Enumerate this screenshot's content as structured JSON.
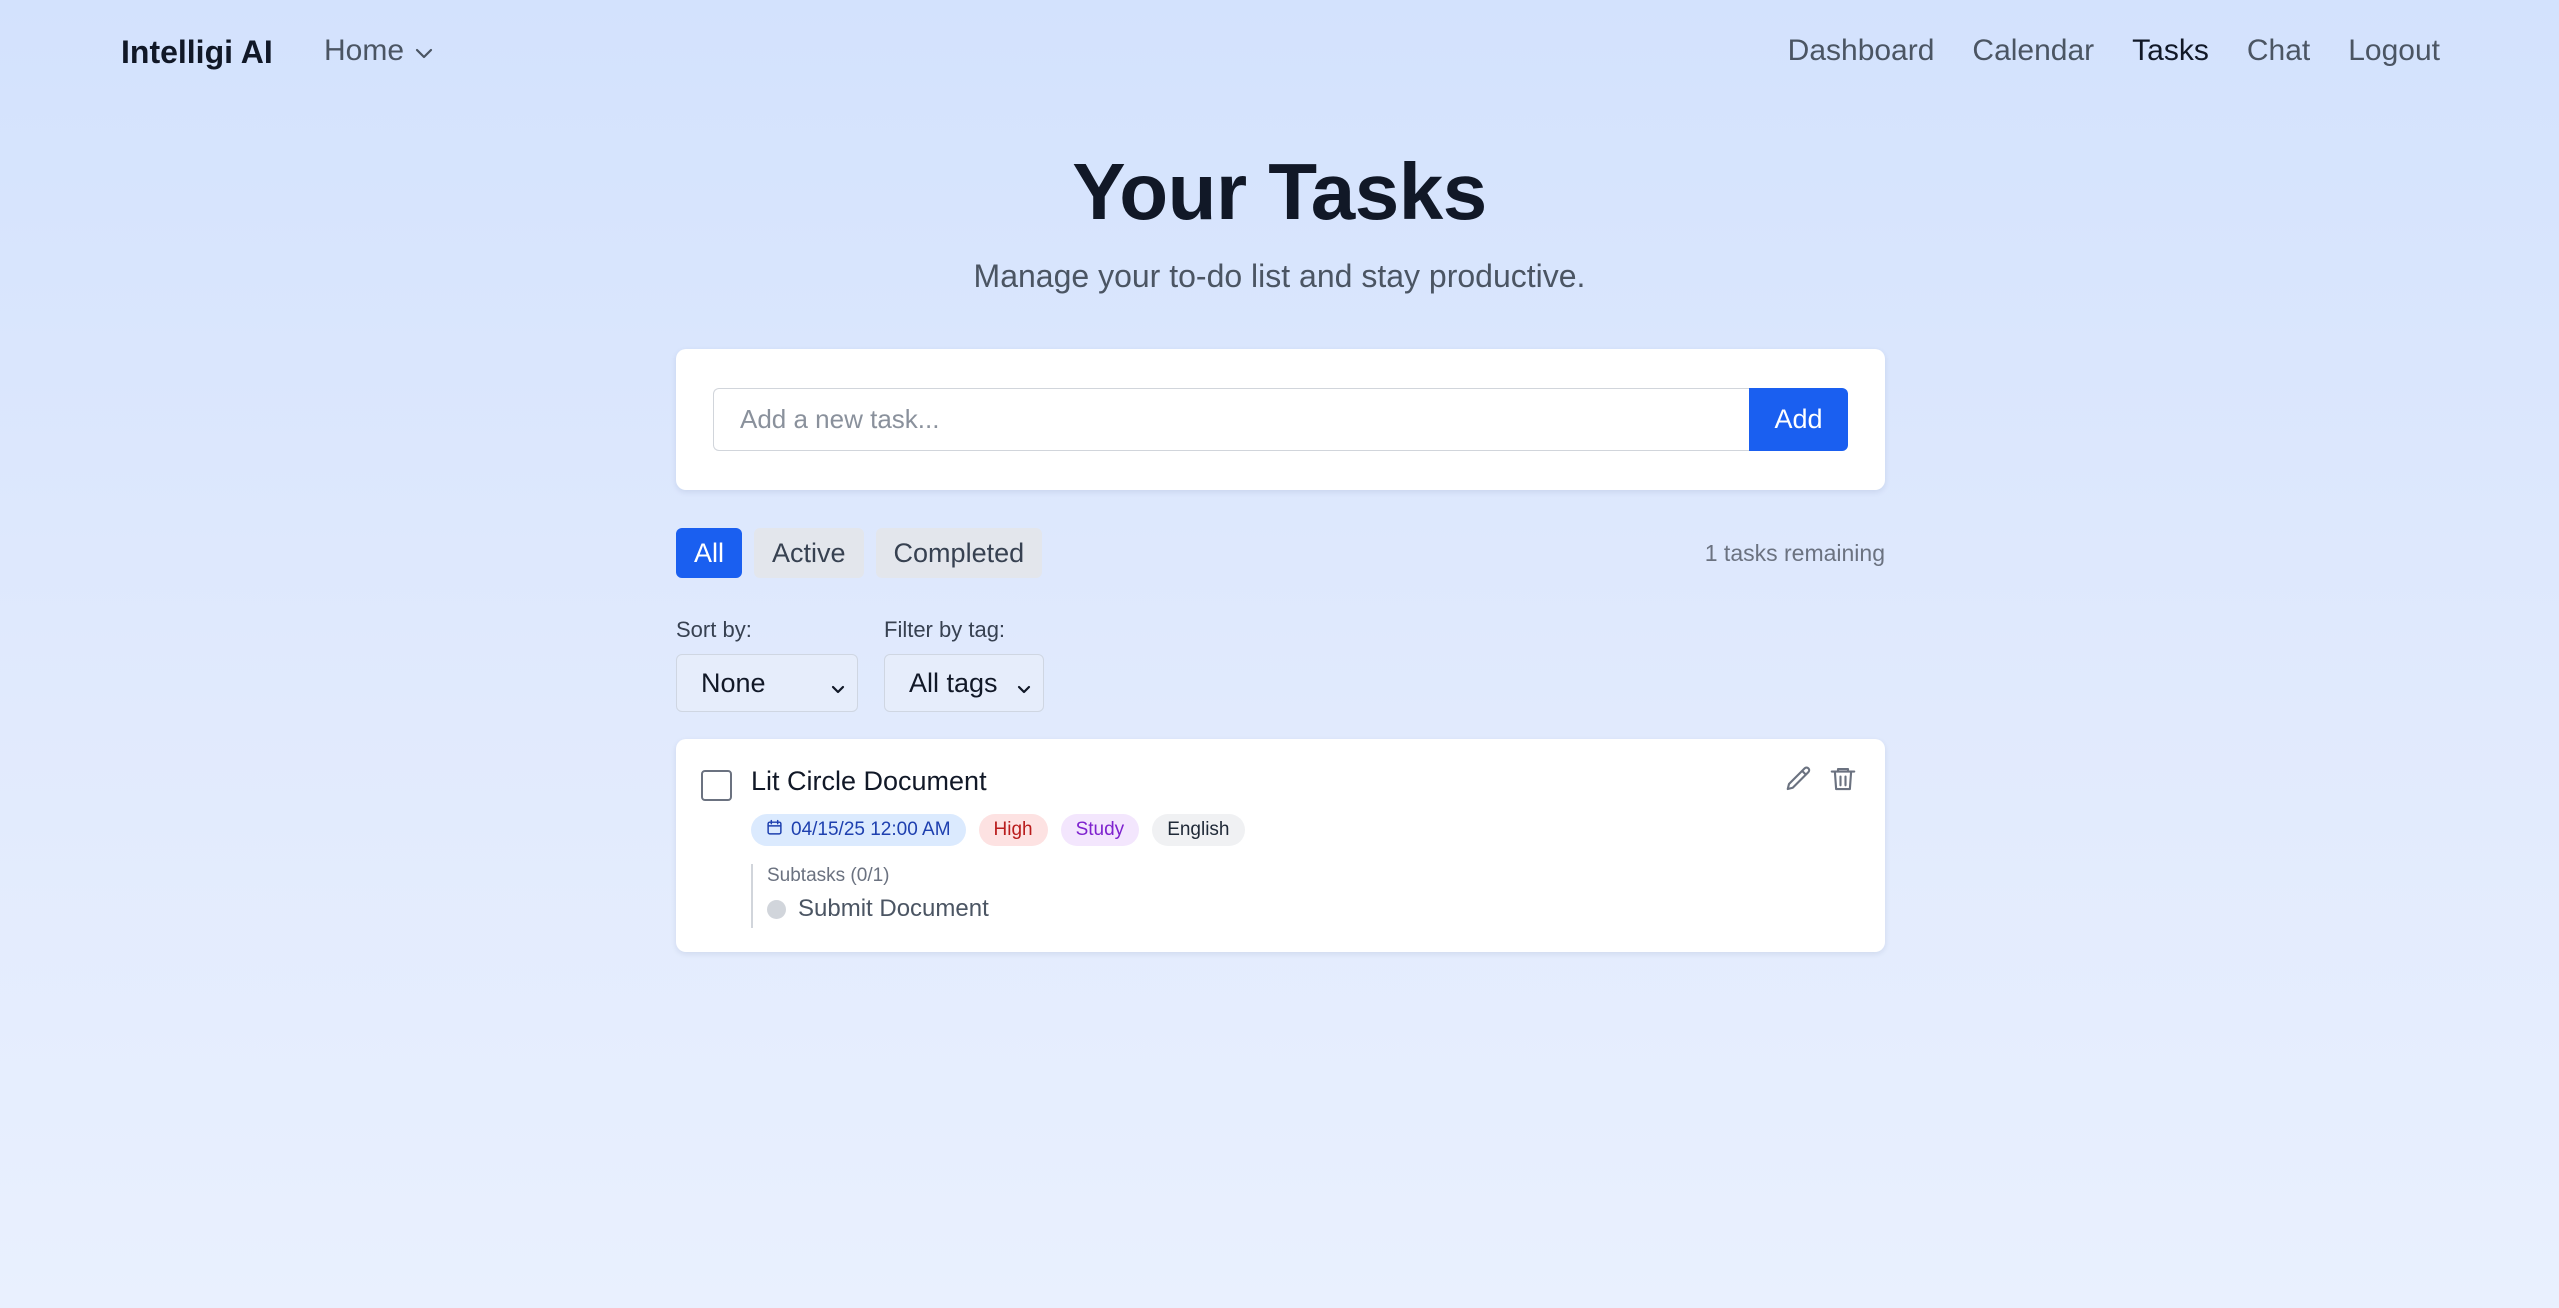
{
  "nav": {
    "brand": "Intelligi AI",
    "home_label": "Home",
    "links": [
      "Dashboard",
      "Calendar",
      "Tasks",
      "Chat",
      "Logout"
    ],
    "active_link": "Tasks"
  },
  "hero": {
    "title": "Your Tasks",
    "subtitle": "Manage your to-do list and stay productive."
  },
  "add_task": {
    "placeholder": "Add a new task...",
    "value": "",
    "button_label": "Add"
  },
  "filters": {
    "tabs": [
      "All",
      "Active",
      "Completed"
    ],
    "active_tab": "All",
    "remaining_text": "1 tasks remaining"
  },
  "controls": {
    "sort_label": "Sort by:",
    "sort_value": "None",
    "tag_label": "Filter by tag:",
    "tag_value": "All tags"
  },
  "tasks": [
    {
      "title": "Lit Circle Document",
      "completed": false,
      "date": "04/15/25 12:00 AM",
      "priority": "High",
      "tags": [
        "Study",
        "English"
      ],
      "subtasks_header": "Subtasks (0/1)",
      "subtasks": [
        {
          "label": "Submit Document",
          "done": false
        }
      ]
    }
  ],
  "colors": {
    "accent": "#1a5ff0",
    "priority_high_bg": "#fde2e2",
    "priority_high_text": "#b91c1c",
    "tag_study_bg": "#f3e6fd",
    "tag_study_text": "#7e22ce",
    "date_bg": "#dbeafe",
    "date_text": "#1e40af"
  },
  "icons": {
    "home_menu": "chevron-down-icon",
    "date": "calendar-icon",
    "edit": "pencil-icon",
    "delete": "trash-icon",
    "select": "chevron-down-icon"
  }
}
